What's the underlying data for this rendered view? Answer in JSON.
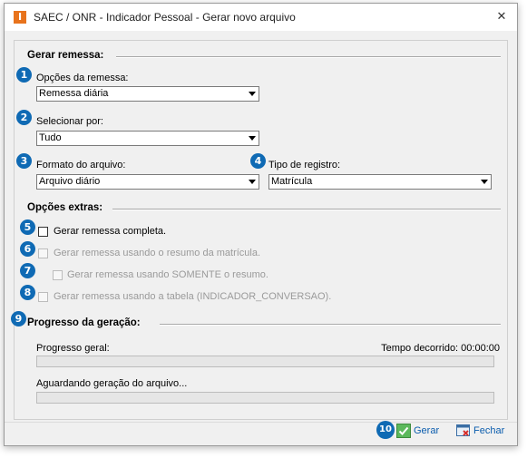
{
  "window": {
    "title": "SAEC / ONR - Indicador Pessoal - Gerar novo arquivo",
    "app_icon_letter": "I",
    "close_glyph": "✕"
  },
  "sections": {
    "gerar_remessa": "Gerar remessa:",
    "opcoes_extras": "Opções extras:",
    "progresso": "Progresso da geração:"
  },
  "fields": {
    "opcoes_remessa": {
      "label": "Opções da remessa:",
      "value": "Remessa diária"
    },
    "selecionar_por": {
      "label": "Selecionar por:",
      "value": "Tudo"
    },
    "formato_arquivo": {
      "label": "Formato do arquivo:",
      "value": "Arquivo diário"
    },
    "tipo_registro": {
      "label": "Tipo de registro:",
      "value": "Matrícula"
    }
  },
  "checkboxes": {
    "completa": "Gerar remessa completa.",
    "resumo_matricula": "Gerar remessa usando o resumo da matrícula.",
    "somente_resumo": "Gerar remessa usando SOMENTE o resumo.",
    "tabela": "Gerar remessa usando a tabela (INDICADOR_CONVERSAO)."
  },
  "progress": {
    "geral_label": "Progresso geral:",
    "tempo_label": "Tempo decorrido: 00:00:00",
    "aguardando_label": "Aguardando geração do arquivo...",
    "geral_value": 0,
    "arquivo_value": 0
  },
  "buttons": {
    "gerar": "Gerar",
    "fechar": "Fechar"
  },
  "badges": [
    "1",
    "2",
    "3",
    "4",
    "5",
    "6",
    "7",
    "8",
    "9",
    "10"
  ],
  "colors": {
    "badge": "#0f6ab4",
    "accent": "#0a5cad",
    "app_icon": "#e8731c"
  }
}
